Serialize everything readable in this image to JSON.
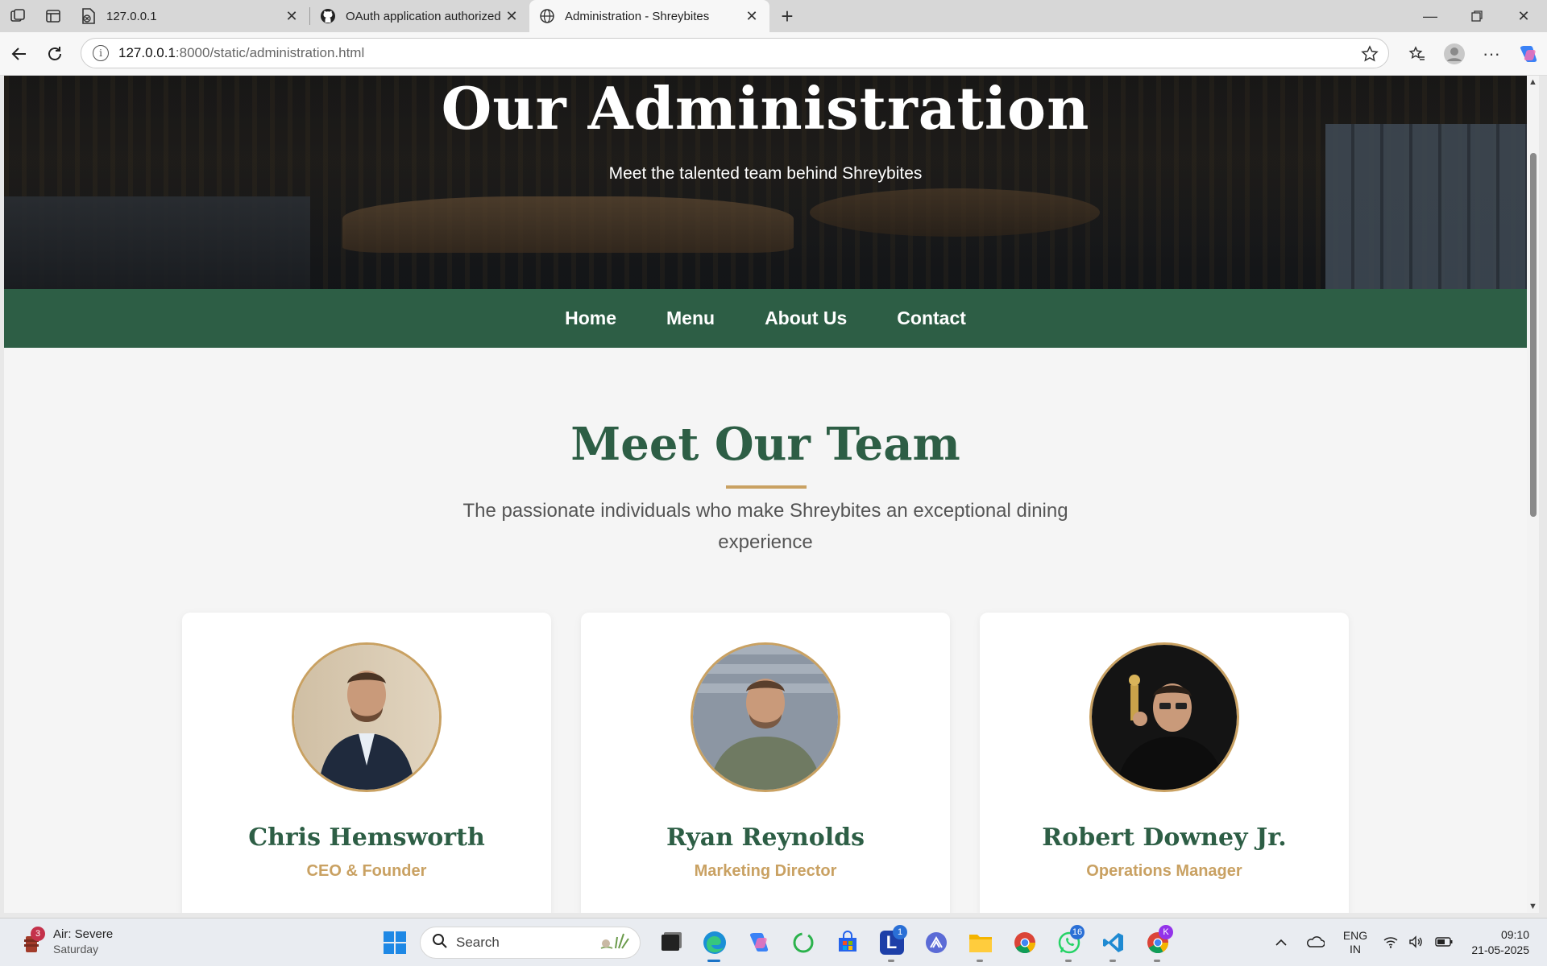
{
  "browser": {
    "tabs": [
      {
        "title": "127.0.0.1",
        "active": false
      },
      {
        "title": "OAuth application authorized",
        "active": false
      },
      {
        "title": "Administration - Shreybites",
        "active": true
      }
    ],
    "url_host": "127.0.0.1",
    "url_path": ":8000/static/administration.html"
  },
  "hero": {
    "title": "Our Administration",
    "subtitle": "Meet the talented team behind Shreybites"
  },
  "nav": {
    "items": [
      "Home",
      "Menu",
      "About Us",
      "Contact"
    ]
  },
  "team": {
    "title": "Meet Our Team",
    "subtitle": "The passionate individuals who make Shreybites an exceptional dining experience",
    "members": [
      {
        "name": "Chris Hemsworth",
        "role": "CEO & Founder"
      },
      {
        "name": "Ryan Reynolds",
        "role": "Marketing Director"
      },
      {
        "name": "Robert Downey Jr.",
        "role": "Operations Manager"
      }
    ]
  },
  "colors": {
    "accent_green": "#2d5e45",
    "gold": "#c9a162"
  },
  "taskbar": {
    "weather_title": "Air: Severe",
    "weather_sub": "Saturday",
    "weather_badge": "3",
    "search_label": "Search",
    "lang_top": "ENG",
    "lang_bottom": "IN",
    "time": "09:10",
    "date": "21-05-2025",
    "badge_l": "1",
    "badge_whatsapp": "16",
    "badge_chrome_profile": "K"
  }
}
